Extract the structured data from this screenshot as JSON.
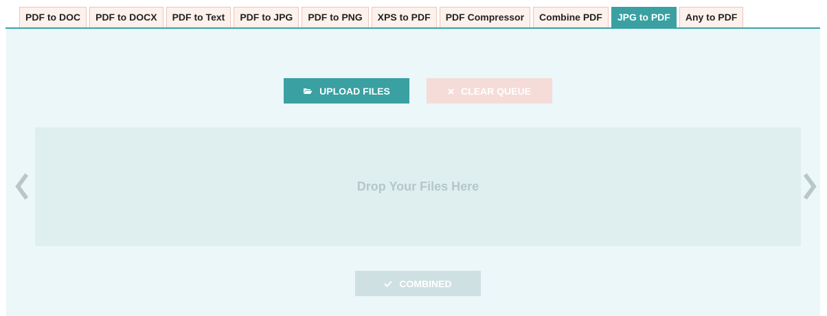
{
  "tabs": [
    {
      "label": "PDF to DOC"
    },
    {
      "label": "PDF to DOCX"
    },
    {
      "label": "PDF to Text"
    },
    {
      "label": "PDF to JPG"
    },
    {
      "label": "PDF to PNG"
    },
    {
      "label": "XPS to PDF"
    },
    {
      "label": "PDF Compressor"
    },
    {
      "label": "Combine PDF"
    },
    {
      "label": "JPG to PDF",
      "active": true
    },
    {
      "label": "Any to PDF"
    }
  ],
  "toolbar": {
    "upload_label": "UPLOAD FILES",
    "upload_icon": "folder-open-icon",
    "clear_label": "CLEAR QUEUE",
    "clear_icon": "close-icon"
  },
  "dropzone": {
    "text": "Drop Your Files Here"
  },
  "carousel": {
    "prev_icon": "chevron-left-icon",
    "next_icon": "chevron-right-icon"
  },
  "footer": {
    "combined_label": "COMBINED",
    "combined_icon": "check-icon"
  },
  "colors": {
    "accent": "#3aa0a2",
    "tab_bg": "#fdf1ec",
    "tab_border": "#ecc5b8",
    "panel_bg": "#ebf7f8",
    "clear_bg": "#f5dcd8",
    "disabled_bg": "#cfe0e2"
  }
}
